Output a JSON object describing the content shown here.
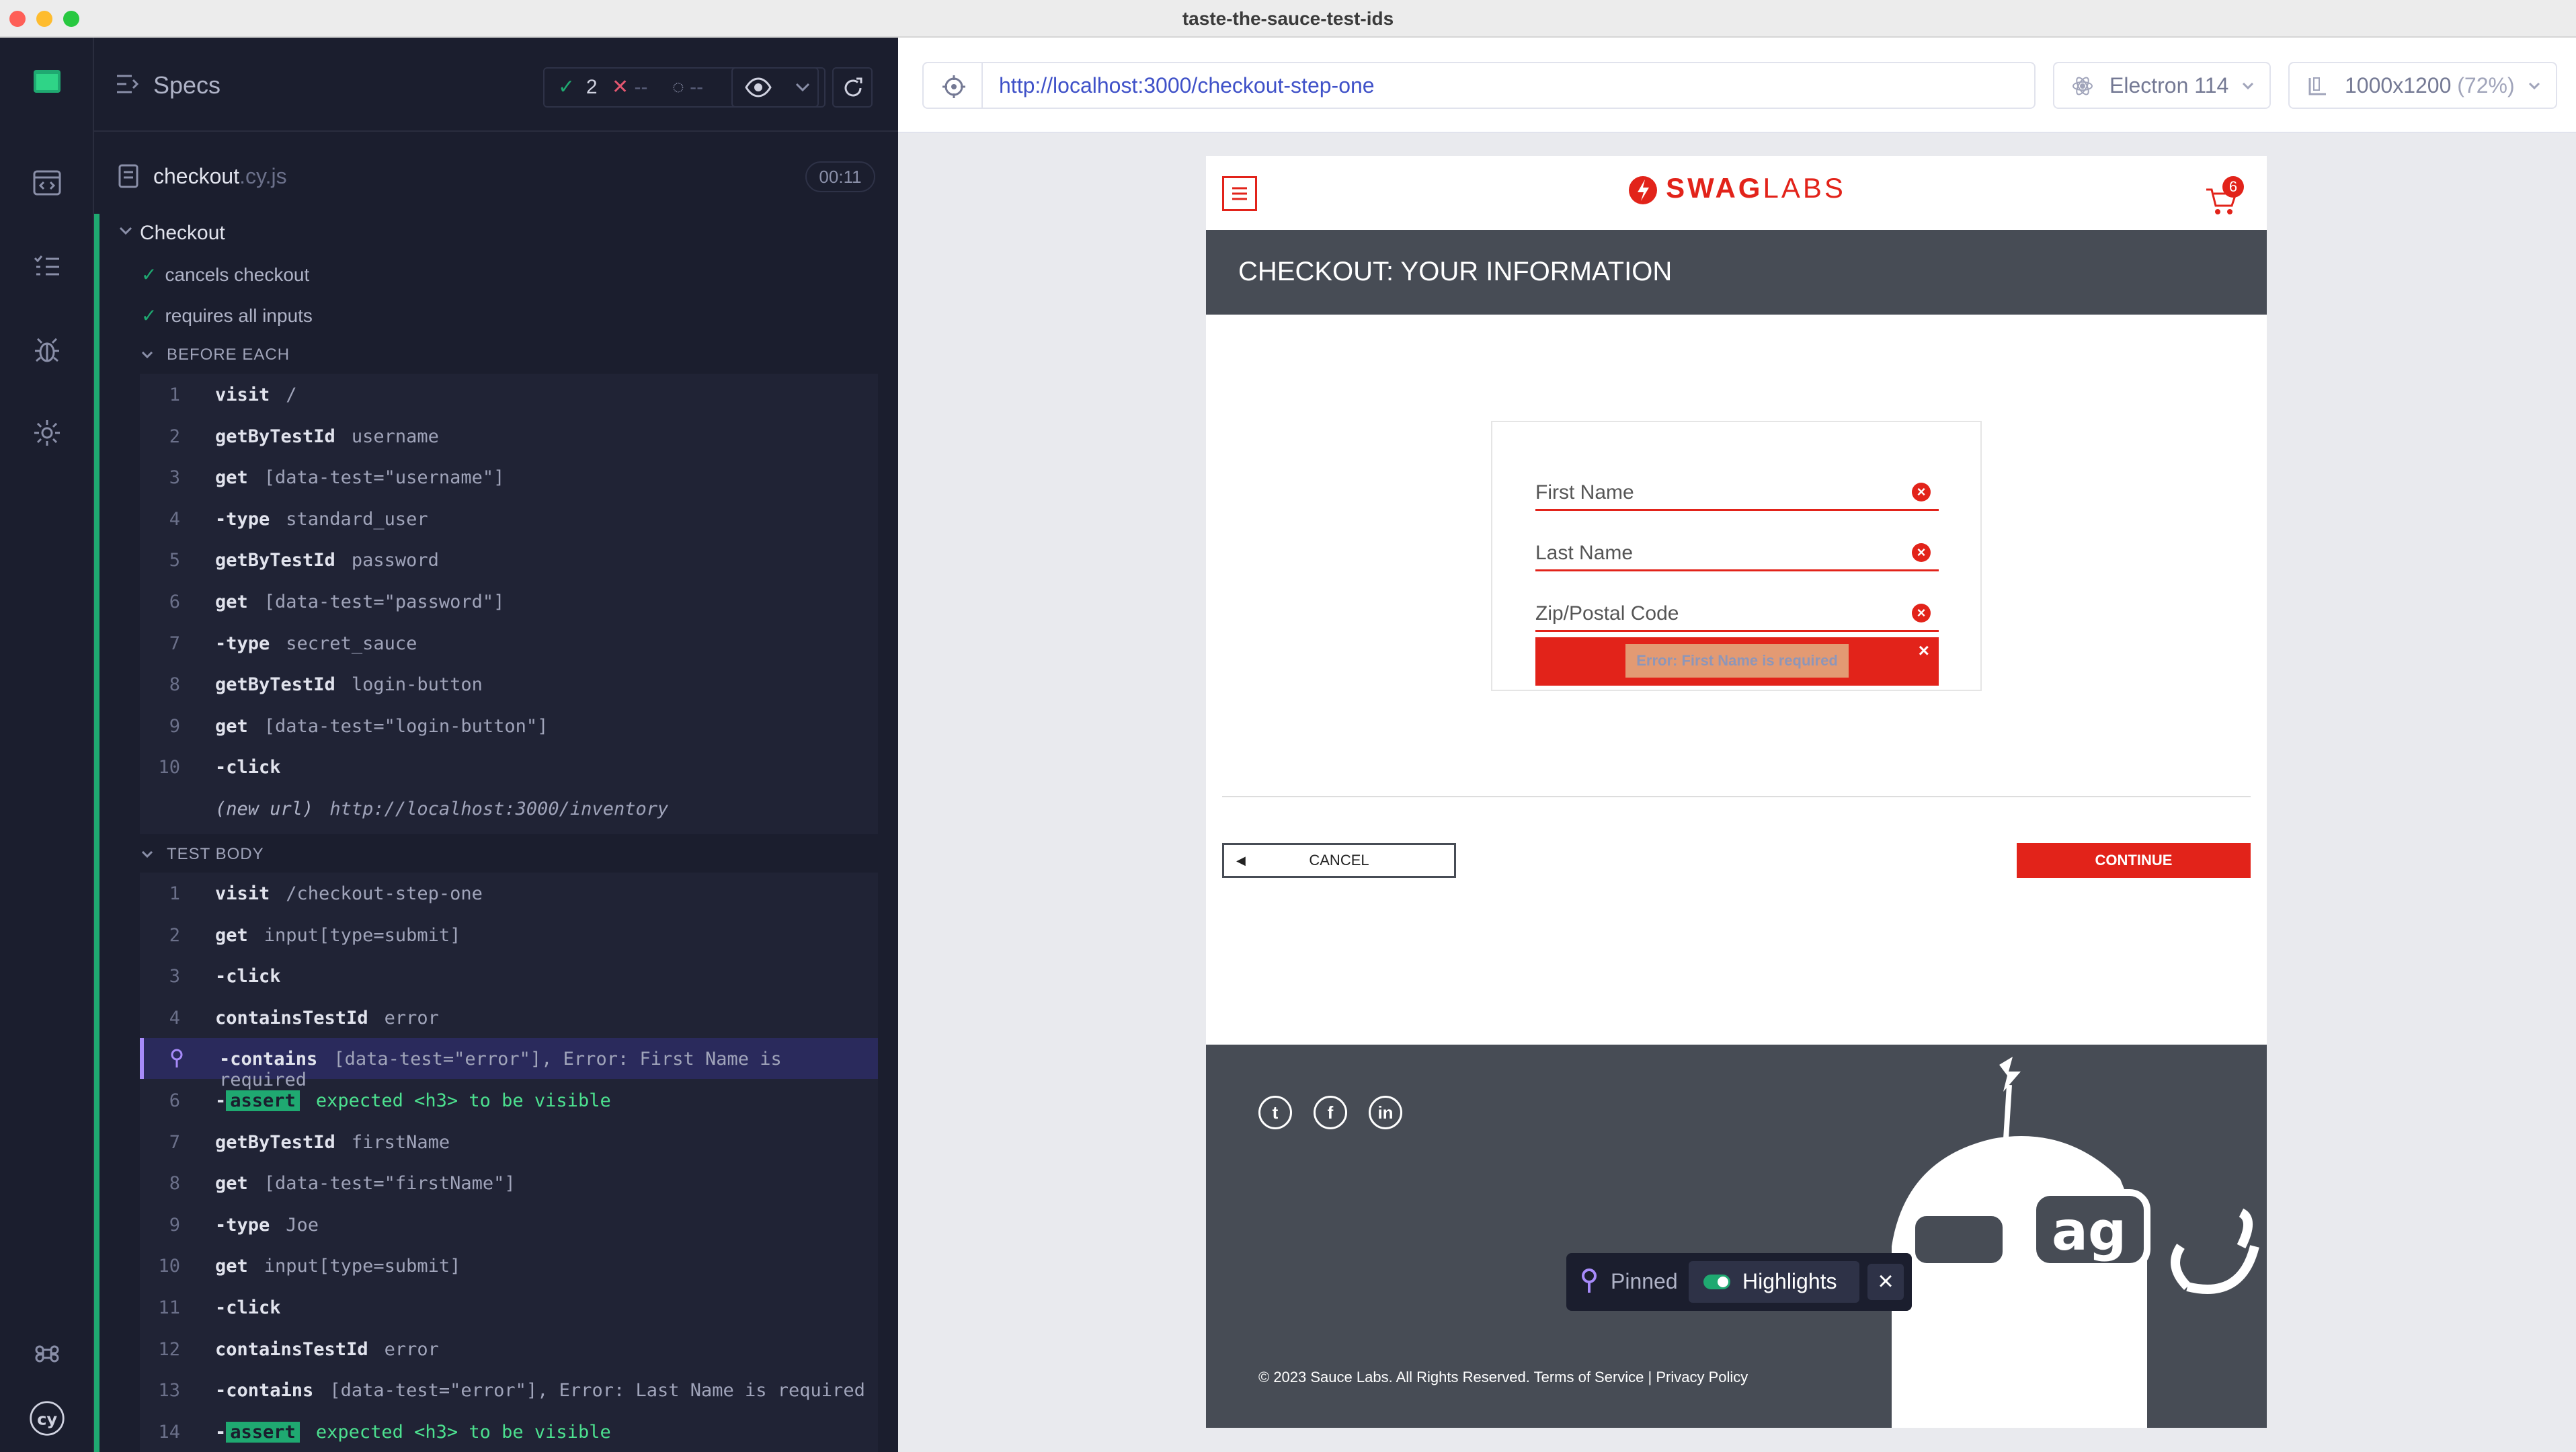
{
  "window": {
    "title": "taste-the-sauce-test-ids"
  },
  "reporter": {
    "specs_label": "Specs",
    "stats": {
      "passed": "2",
      "failed": "--",
      "pending": "--"
    },
    "spec_file": {
      "name": "checkout",
      "ext": ".cy.js",
      "duration": "00:11"
    },
    "suite": "Checkout",
    "tests": [
      {
        "title": "cancels checkout"
      },
      {
        "title": "requires all inputs"
      }
    ],
    "before_each": {
      "title": "BEFORE EACH",
      "commands": [
        {
          "num": "1",
          "name": "visit",
          "msg": "/"
        },
        {
          "num": "2",
          "name": "getByTestId",
          "msg": "username"
        },
        {
          "num": "3",
          "name": "get",
          "msg": "[data-test=\"username\"]"
        },
        {
          "num": "4",
          "name": "-type",
          "msg": "standard_user"
        },
        {
          "num": "5",
          "name": "getByTestId",
          "msg": "password"
        },
        {
          "num": "6",
          "name": "get",
          "msg": "[data-test=\"password\"]"
        },
        {
          "num": "7",
          "name": "-type",
          "msg": "secret_sauce"
        },
        {
          "num": "8",
          "name": "getByTestId",
          "msg": "login-button"
        },
        {
          "num": "9",
          "name": "get",
          "msg": "[data-test=\"login-button\"]"
        },
        {
          "num": "10",
          "name": "-click",
          "msg": ""
        },
        {
          "num": "",
          "name": "(new url)",
          "msg": "http://localhost:3000/inventory"
        }
      ]
    },
    "test_body": {
      "title": "TEST BODY",
      "commands": [
        {
          "num": "1",
          "name": "visit",
          "msg": "/checkout-step-one"
        },
        {
          "num": "2",
          "name": "get",
          "msg": "input[type=submit]"
        },
        {
          "num": "3",
          "name": "-click",
          "msg": ""
        },
        {
          "num": "4",
          "name": "containsTestId",
          "msg": "error"
        },
        {
          "num": "5",
          "name": "-contains",
          "msg": "[data-test=\"error\"], Error: First Name is required"
        },
        {
          "num": "6",
          "name": "-",
          "badge": "assert",
          "msg": "expected <h3> to be visible"
        },
        {
          "num": "7",
          "name": "getByTestId",
          "msg": "firstName"
        },
        {
          "num": "8",
          "name": "get",
          "msg": "[data-test=\"firstName\"]"
        },
        {
          "num": "9",
          "name": "-type",
          "msg": "Joe"
        },
        {
          "num": "10",
          "name": "get",
          "msg": "input[type=submit]"
        },
        {
          "num": "11",
          "name": "-click",
          "msg": ""
        },
        {
          "num": "12",
          "name": "containsTestId",
          "msg": "error"
        },
        {
          "num": "13",
          "name": "-contains",
          "msg": "[data-test=\"error\"], Error: Last Name is required"
        },
        {
          "num": "14",
          "name": "-",
          "badge": "assert",
          "msg": "expected <h3> to be visible"
        }
      ]
    }
  },
  "aut_header": {
    "url": "http://localhost:3000/checkout-step-one",
    "browser": "Electron 114",
    "viewport": "1000x1200",
    "viewport_pct": "(72%)"
  },
  "app": {
    "logo_bold": "SWAG",
    "logo_light": "LABS",
    "cart_count": "6",
    "heading": "CHECKOUT: YOUR INFORMATION",
    "fields": {
      "first_name_placeholder": "First Name",
      "last_name_placeholder": "Last Name",
      "zip_placeholder": "Zip/Postal Code"
    },
    "error_message": "Error: First Name is required",
    "cancel_label": "CANCEL",
    "continue_label": "CONTINUE",
    "copyright": "© 2023 Sauce Labs. All Rights Reserved. Terms of Service | Privacy Policy",
    "robot_text": "ag"
  },
  "pinned_bar": {
    "pinned_label": "Pinned",
    "highlights_label": "Highlights"
  },
  "colors": {
    "accent_green": "#1fa971",
    "sauce_red": "#e2231a",
    "pinned_purple": "#a78bfa"
  }
}
